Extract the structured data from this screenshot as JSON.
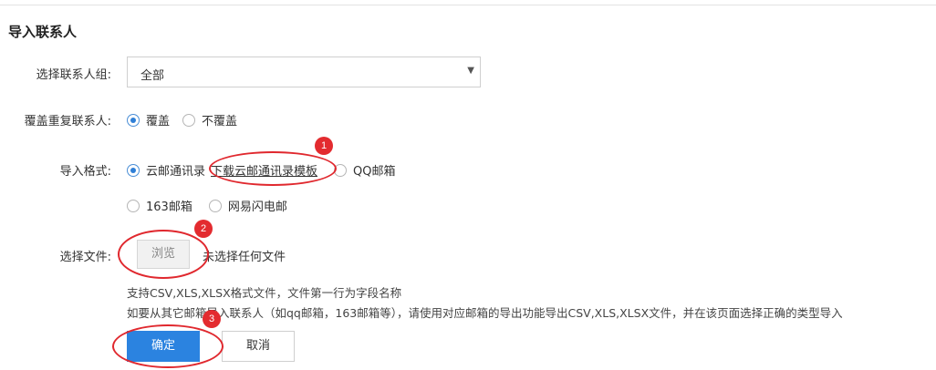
{
  "page": {
    "title": "导入联系人"
  },
  "form": {
    "group": {
      "label": "选择联系人组:",
      "selected": "全部"
    },
    "overwrite": {
      "label": "覆盖重复联系人:",
      "options": [
        {
          "label": "覆盖",
          "checked": true
        },
        {
          "label": "不覆盖",
          "checked": false
        }
      ]
    },
    "format": {
      "label": "导入格式:",
      "options": [
        {
          "label": "云邮通讯录",
          "checked": true
        },
        {
          "label": "QQ邮箱",
          "checked": false
        },
        {
          "label": "163邮箱",
          "checked": false
        },
        {
          "label": "网易闪电邮",
          "checked": false
        }
      ],
      "template_link": "下载云邮通讯录模板"
    },
    "file": {
      "label": "选择文件:",
      "browse_label": "浏览",
      "no_file_text": "未选择任何文件"
    },
    "hints": {
      "line1": "支持CSV,XLS,XLSX格式文件，文件第一行为字段名称",
      "line2": "如要从其它邮箱导入联系人（如qq邮箱，163邮箱等），请使用对应邮箱的导出功能导出CSV,XLS,XLSX文件，并在该页面选择正确的类型导入"
    },
    "actions": {
      "confirm_label": "确定",
      "cancel_label": "取消"
    }
  },
  "annotations": {
    "badges": [
      "1",
      "2",
      "3"
    ],
    "color": "#e0282e"
  },
  "colors": {
    "primary": "#2b83e0",
    "radio_checked": "#2f7fd6"
  }
}
